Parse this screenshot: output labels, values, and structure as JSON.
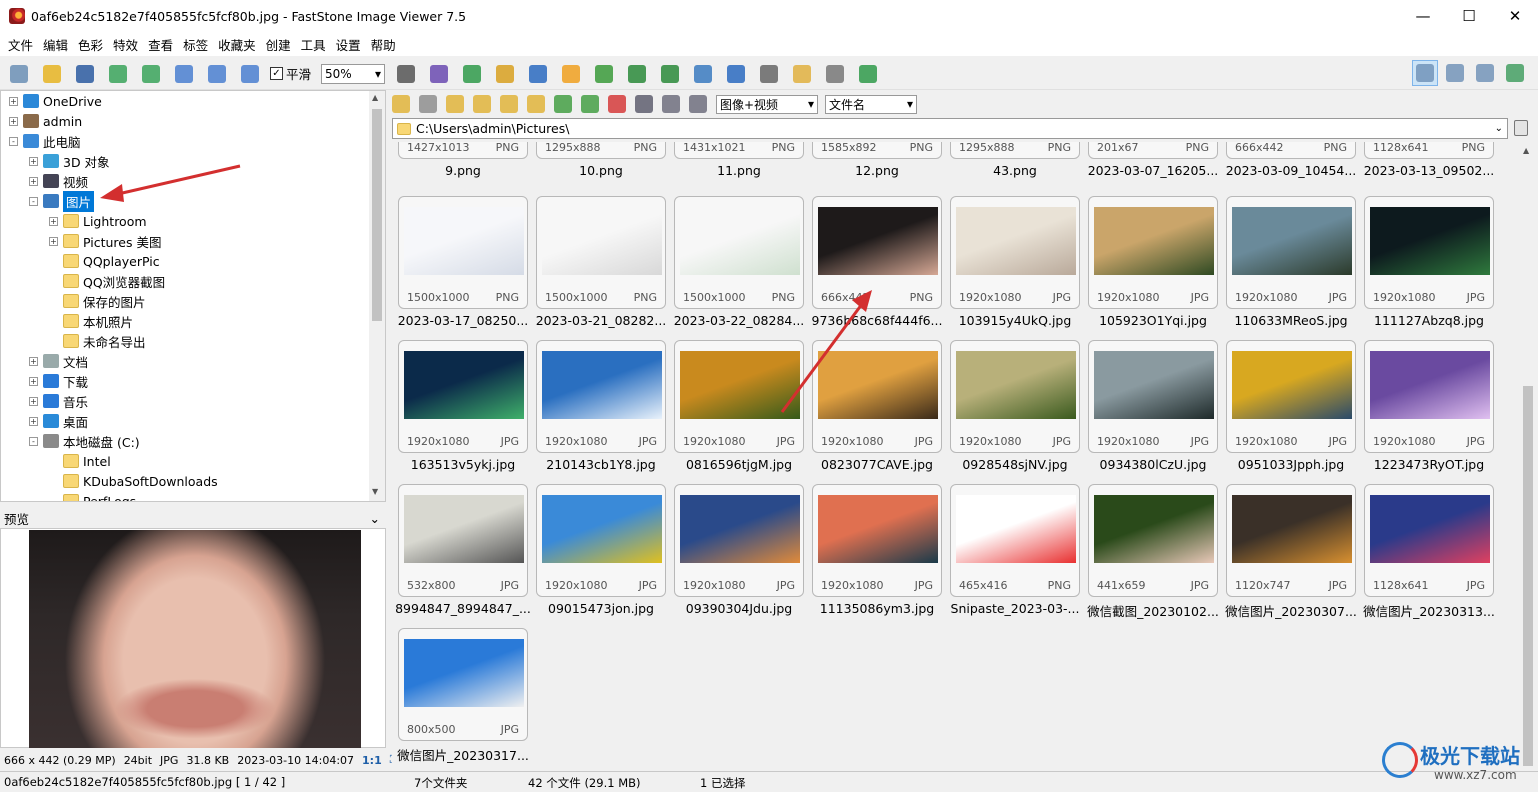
{
  "window": {
    "title": "0af6eb24c5182e7f405855fc5fcf80b.jpg  -  FastStone Image Viewer 7.5"
  },
  "menu": [
    "文件",
    "编辑",
    "色彩",
    "特效",
    "查看",
    "标签",
    "收藏夹",
    "创建",
    "工具",
    "设置",
    "帮助"
  ],
  "toolbar": {
    "smooth_label": "平滑",
    "smooth_checked": true,
    "zoom_value": "50%",
    "icons": [
      "camera-icon",
      "open-folder-icon",
      "save-icon",
      "previous-icon",
      "next-icon",
      "zoom-in-icon",
      "zoom-out-icon",
      "actual-size-icon"
    ],
    "icons2": [
      "hand-tool-icon",
      "film-strip-icon",
      "export-icon",
      "crop-icon",
      "color-cb-icon",
      "brightness-icon",
      "stamp-icon",
      "rotate-left-icon",
      "rotate-right-icon",
      "flip-icon",
      "resize-icon",
      "draw-icon",
      "email-icon",
      "print-icon",
      "batch-icon"
    ],
    "view_icons": [
      "thumbnail-view-icon",
      "explorer-view-icon",
      "portrait-view-icon",
      "fullscreen-icon"
    ]
  },
  "tree": {
    "items": [
      {
        "label": "OneDrive",
        "indent": 0,
        "icon": "cloud-icon",
        "expander": "+"
      },
      {
        "label": "admin",
        "indent": 0,
        "icon": "user-icon",
        "expander": "+"
      },
      {
        "label": "此电脑",
        "indent": 0,
        "icon": "computer-icon",
        "expander": "-"
      },
      {
        "label": "3D 对象",
        "indent": 1,
        "icon": "cube-icon",
        "expander": "+"
      },
      {
        "label": "视频",
        "indent": 1,
        "icon": "video-icon",
        "expander": "+"
      },
      {
        "label": "图片",
        "indent": 1,
        "icon": "pictures-icon",
        "expander": "-",
        "selected": true
      },
      {
        "label": "Lightroom",
        "indent": 2,
        "icon": "folder-icon",
        "expander": "+"
      },
      {
        "label": "Pictures 美图",
        "indent": 2,
        "icon": "folder-icon",
        "expander": "+"
      },
      {
        "label": "QQplayerPic",
        "indent": 2,
        "icon": "folder-icon",
        "expander": ""
      },
      {
        "label": "QQ浏览器截图",
        "indent": 2,
        "icon": "folder-icon",
        "expander": ""
      },
      {
        "label": "保存的图片",
        "indent": 2,
        "icon": "folder-icon",
        "expander": ""
      },
      {
        "label": "本机照片",
        "indent": 2,
        "icon": "folder-icon",
        "expander": ""
      },
      {
        "label": "未命名导出",
        "indent": 2,
        "icon": "folder-icon",
        "expander": ""
      },
      {
        "label": "文档",
        "indent": 1,
        "icon": "documents-icon",
        "expander": "+"
      },
      {
        "label": "下载",
        "indent": 1,
        "icon": "download-icon",
        "expander": "+"
      },
      {
        "label": "音乐",
        "indent": 1,
        "icon": "music-icon",
        "expander": "+"
      },
      {
        "label": "桌面",
        "indent": 1,
        "icon": "desktop-icon",
        "expander": "+"
      },
      {
        "label": "本地磁盘 (C:)",
        "indent": 1,
        "icon": "drive-icon",
        "expander": "-"
      },
      {
        "label": "Intel",
        "indent": 2,
        "icon": "folder-icon",
        "expander": ""
      },
      {
        "label": "KDubaSoftDownloads",
        "indent": 2,
        "icon": "folder-icon",
        "expander": ""
      },
      {
        "label": "PerfLogs",
        "indent": 2,
        "icon": "folder-icon",
        "expander": ""
      }
    ]
  },
  "preview": {
    "header": "预览",
    "dimensions": "666 x 442 (0.29 MP)",
    "bitdepth": "24bit",
    "format": "JPG",
    "filesize": "31.8 KB",
    "datetime": "2023-03-10 14:04:07",
    "ratio": "1:1"
  },
  "browser": {
    "filter_value": "图像+视频",
    "sort_value": "文件名",
    "path": "C:\\Users\\admin\\Pictures\\",
    "nav_icons": [
      "back-icon",
      "forward-icon",
      "up-folder-icon",
      "refresh-icon",
      "new-folder-icon",
      "favorite-icon",
      "copy-to-icon",
      "move-to-icon",
      "delete-icon",
      "select-all-icon",
      "details-view-icon",
      "list-view-icon"
    ]
  },
  "thumbnails": [
    {
      "dims": "1427x1013",
      "ext": "PNG",
      "name": "9.png",
      "colors": [
        "#f4f4f4",
        "#c9d3e0"
      ],
      "partial": true
    },
    {
      "dims": "1295x888",
      "ext": "PNG",
      "name": "10.png",
      "colors": [
        "#f4f4f4",
        "#dcdcdc"
      ],
      "partial": true
    },
    {
      "dims": "1431x1021",
      "ext": "PNG",
      "name": "11.png",
      "colors": [
        "#3a3a3a",
        "#dcdcdc"
      ],
      "partial": true
    },
    {
      "dims": "1585x892",
      "ext": "PNG",
      "name": "12.png",
      "colors": [
        "#f4f4f4",
        "#e4e4e4"
      ],
      "partial": true
    },
    {
      "dims": "1295x888",
      "ext": "PNG",
      "name": "43.png",
      "colors": [
        "#f4f4f4",
        "#e4e4e4"
      ],
      "partial": true
    },
    {
      "dims": "201x67",
      "ext": "PNG",
      "name": "2023-03-07_16205...",
      "colors": [
        "#f4f4f4",
        "#e4e4e4"
      ],
      "partial": true
    },
    {
      "dims": "666x442",
      "ext": "PNG",
      "name": "2023-03-09_10454...",
      "colors": [
        "#f4f4f4",
        "#e4e4e4"
      ],
      "partial": true
    },
    {
      "dims": "1128x641",
      "ext": "PNG",
      "name": "2023-03-13_09502...",
      "colors": [
        "#f4f4f4",
        "#e4e4e4"
      ],
      "partial": true
    },
    {
      "dims": "1500x1000",
      "ext": "PNG",
      "name": "2023-03-17_08250...",
      "colors": [
        "#f6f7fa",
        "#d5dbe6"
      ]
    },
    {
      "dims": "1500x1000",
      "ext": "PNG",
      "name": "2023-03-21_08282...",
      "colors": [
        "#f7f7f7",
        "#d8d8d8"
      ]
    },
    {
      "dims": "1500x1000",
      "ext": "PNG",
      "name": "2023-03-22_08284...",
      "colors": [
        "#f7f7f7",
        "#cfe0cf"
      ]
    },
    {
      "dims": "666x442",
      "ext": "PNG",
      "name": "9736b68c68f444f6...",
      "colors": [
        "#1e1a1a",
        "#d6a895"
      ]
    },
    {
      "dims": "1920x1080",
      "ext": "JPG",
      "name": "103915y4UkQ.jpg",
      "colors": [
        "#e9e2d6",
        "#b9a99a"
      ]
    },
    {
      "dims": "1920x1080",
      "ext": "JPG",
      "name": "105923O1Yqi.jpg",
      "colors": [
        "#caa56a",
        "#2f4a23"
      ]
    },
    {
      "dims": "1920x1080",
      "ext": "JPG",
      "name": "110633MReoS.jpg",
      "colors": [
        "#6a8a9a",
        "#2b3a2a"
      ]
    },
    {
      "dims": "1920x1080",
      "ext": "JPG",
      "name": "111127Abzq8.jpg",
      "colors": [
        "#0d1a1e",
        "#2f7a3d"
      ]
    },
    {
      "dims": "1920x1080",
      "ext": "JPG",
      "name": "163513v5ykj.jpg",
      "colors": [
        "#0b2a4a",
        "#3fb06a"
      ]
    },
    {
      "dims": "1920x1080",
      "ext": "JPG",
      "name": "210143cb1Y8.jpg",
      "colors": [
        "#2a6fc0",
        "#e9f2fb"
      ]
    },
    {
      "dims": "1920x1080",
      "ext": "JPG",
      "name": "0816596tjgM.jpg",
      "colors": [
        "#c98a1e",
        "#355a1a"
      ]
    },
    {
      "dims": "1920x1080",
      "ext": "JPG",
      "name": "0823077CAVE.jpg",
      "colors": [
        "#e0a040",
        "#3a2a1a"
      ]
    },
    {
      "dims": "1920x1080",
      "ext": "JPG",
      "name": "0928548sjNV.jpg",
      "colors": [
        "#b8b07a",
        "#3a5a1e"
      ]
    },
    {
      "dims": "1920x1080",
      "ext": "JPG",
      "name": "0934380lCzU.jpg",
      "colors": [
        "#8a9aa0",
        "#1e2a2a"
      ]
    },
    {
      "dims": "1920x1080",
      "ext": "JPG",
      "name": "0951033Jpph.jpg",
      "colors": [
        "#d8a820",
        "#2a4a6a"
      ]
    },
    {
      "dims": "1920x1080",
      "ext": "JPG",
      "name": "1223473RyOT.jpg",
      "colors": [
        "#6a4aa0",
        "#e0c0f0"
      ]
    },
    {
      "dims": "532x800",
      "ext": "JPG",
      "name": "8994847_8994847_...",
      "colors": [
        "#d8d8d0",
        "#555555"
      ]
    },
    {
      "dims": "1920x1080",
      "ext": "JPG",
      "name": "09015473jon.jpg",
      "colors": [
        "#3a8ad8",
        "#e0c020"
      ]
    },
    {
      "dims": "1920x1080",
      "ext": "JPG",
      "name": "09390304Jdu.jpg",
      "colors": [
        "#2a4a8a",
        "#e08a3a"
      ]
    },
    {
      "dims": "1920x1080",
      "ext": "JPG",
      "name": "11135086ym3.jpg",
      "colors": [
        "#e07050",
        "#1a3a4a"
      ]
    },
    {
      "dims": "465x416",
      "ext": "PNG",
      "name": "Snipaste_2023-03-...",
      "colors": [
        "#ffffff",
        "#e83030"
      ]
    },
    {
      "dims": "441x659",
      "ext": "JPG",
      "name": "微信截图_20230102...",
      "colors": [
        "#2a4a1a",
        "#e8c8b8"
      ]
    },
    {
      "dims": "1120x747",
      "ext": "JPG",
      "name": "微信图片_20230307...",
      "colors": [
        "#3a3028",
        "#d89030"
      ]
    },
    {
      "dims": "1128x641",
      "ext": "JPG",
      "name": "微信图片_20230313...",
      "colors": [
        "#2a3a8a",
        "#e04060"
      ]
    },
    {
      "dims": "800x500",
      "ext": "JPG",
      "name": "微信图片_20230317...",
      "colors": [
        "#2a7ad8",
        "#f0f0f0"
      ]
    }
  ],
  "status": {
    "filename": "0af6eb24c5182e7f405855fc5fcf80b.jpg [ 1 / 42 ]",
    "folders": "7个文件夹",
    "files": "42 个文件 (29.1 MB)",
    "selected": "1 已选择"
  },
  "watermark": {
    "text": "极光下载站",
    "url": "www.xz7.com"
  },
  "colors": {
    "selection": "#0078d7",
    "annotation_arrow": "#d32f2f"
  }
}
